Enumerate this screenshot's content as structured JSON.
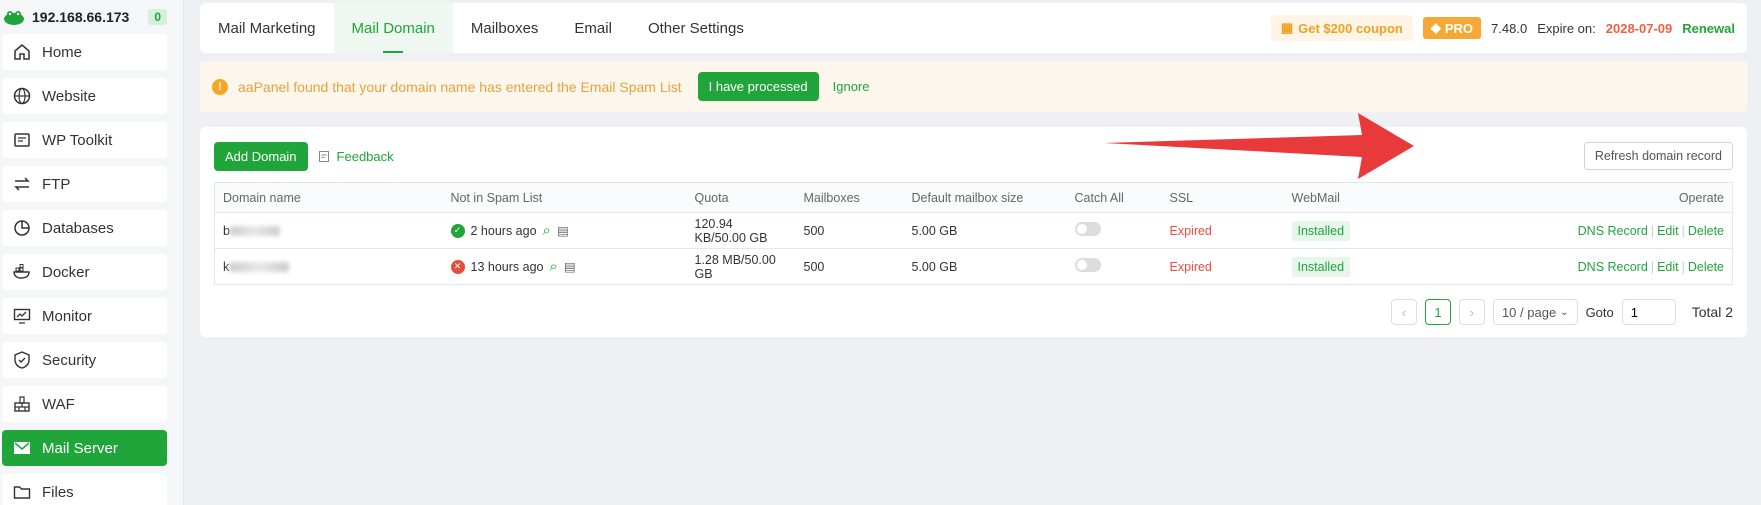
{
  "sidebar": {
    "ip": "192.168.66.173",
    "badge": "0",
    "items": [
      {
        "label": "Home",
        "icon": "home-icon"
      },
      {
        "label": "Website",
        "icon": "globe-icon"
      },
      {
        "label": "WP Toolkit",
        "icon": "wp-icon"
      },
      {
        "label": "FTP",
        "icon": "ftp-icon"
      },
      {
        "label": "Databases",
        "icon": "database-icon"
      },
      {
        "label": "Docker",
        "icon": "docker-icon"
      },
      {
        "label": "Monitor",
        "icon": "monitor-icon"
      },
      {
        "label": "Security",
        "icon": "shield-icon"
      },
      {
        "label": "WAF",
        "icon": "waf-icon"
      },
      {
        "label": "Mail Server",
        "icon": "mail-icon"
      },
      {
        "label": "Files",
        "icon": "folder-icon"
      }
    ]
  },
  "tabs": [
    "Mail Marketing",
    "Mail Domain",
    "Mailboxes",
    "Email",
    "Other Settings"
  ],
  "topright": {
    "coupon": "Get $200 coupon",
    "pro": "PRO",
    "version": "7.48.0",
    "expire_label": "Expire on:",
    "expire_date": "2028-07-09",
    "renewal": "Renewal"
  },
  "alert": {
    "text": "aaPanel found that your domain name has entered the Email Spam List",
    "processed": "I have processed",
    "ignore": "Ignore"
  },
  "toolbar": {
    "add": "Add Domain",
    "feedback": "Feedback",
    "refresh": "Refresh domain record"
  },
  "table": {
    "headers": [
      "Domain name",
      "Not in Spam List",
      "Quota",
      "Mailboxes",
      "Default mailbox size",
      "Catch All",
      "SSL",
      "WebMail",
      "Operate"
    ],
    "rows": [
      {
        "domain_prefix": "b",
        "spam_time": "2 hours ago",
        "quota": "120.94 KB/50.00 GB",
        "mailboxes": "500",
        "size": "5.00 GB",
        "ssl": "Expired",
        "webmail": "Installed"
      },
      {
        "domain_prefix": "k",
        "spam_time": "13 hours ago",
        "quota": "1.28 MB/50.00 GB",
        "mailboxes": "500",
        "size": "5.00 GB",
        "ssl": "Expired",
        "webmail": "Installed"
      }
    ],
    "ops": [
      "DNS Record",
      "Edit",
      "Delete"
    ]
  },
  "pager": {
    "page": "1",
    "size": "10 / page",
    "goto_label": "Goto",
    "goto_value": "1",
    "total": "Total 2"
  }
}
